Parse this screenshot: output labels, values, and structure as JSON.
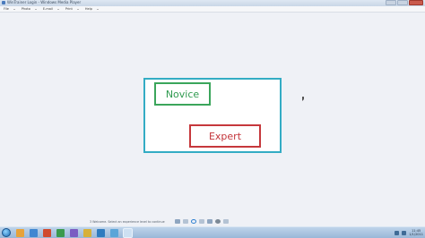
{
  "window": {
    "title": "WinTrainer Login - Windows Media Player"
  },
  "menu": {
    "items": [
      {
        "label": "File"
      },
      {
        "label": "Photo"
      },
      {
        "label": "E-mail"
      },
      {
        "label": "Print"
      },
      {
        "label": "Help"
      }
    ]
  },
  "card": {
    "novice_label": "Novice",
    "expert_label": "Expert"
  },
  "status": {
    "text": "3  Welcome. Select an experience level to continue"
  },
  "taskbar": {
    "clock_time": "11:45",
    "clock_date": "1/1/2011"
  },
  "colors": {
    "card_border": "#33acc4",
    "novice": "#3ba55b",
    "expert": "#c6383c"
  }
}
